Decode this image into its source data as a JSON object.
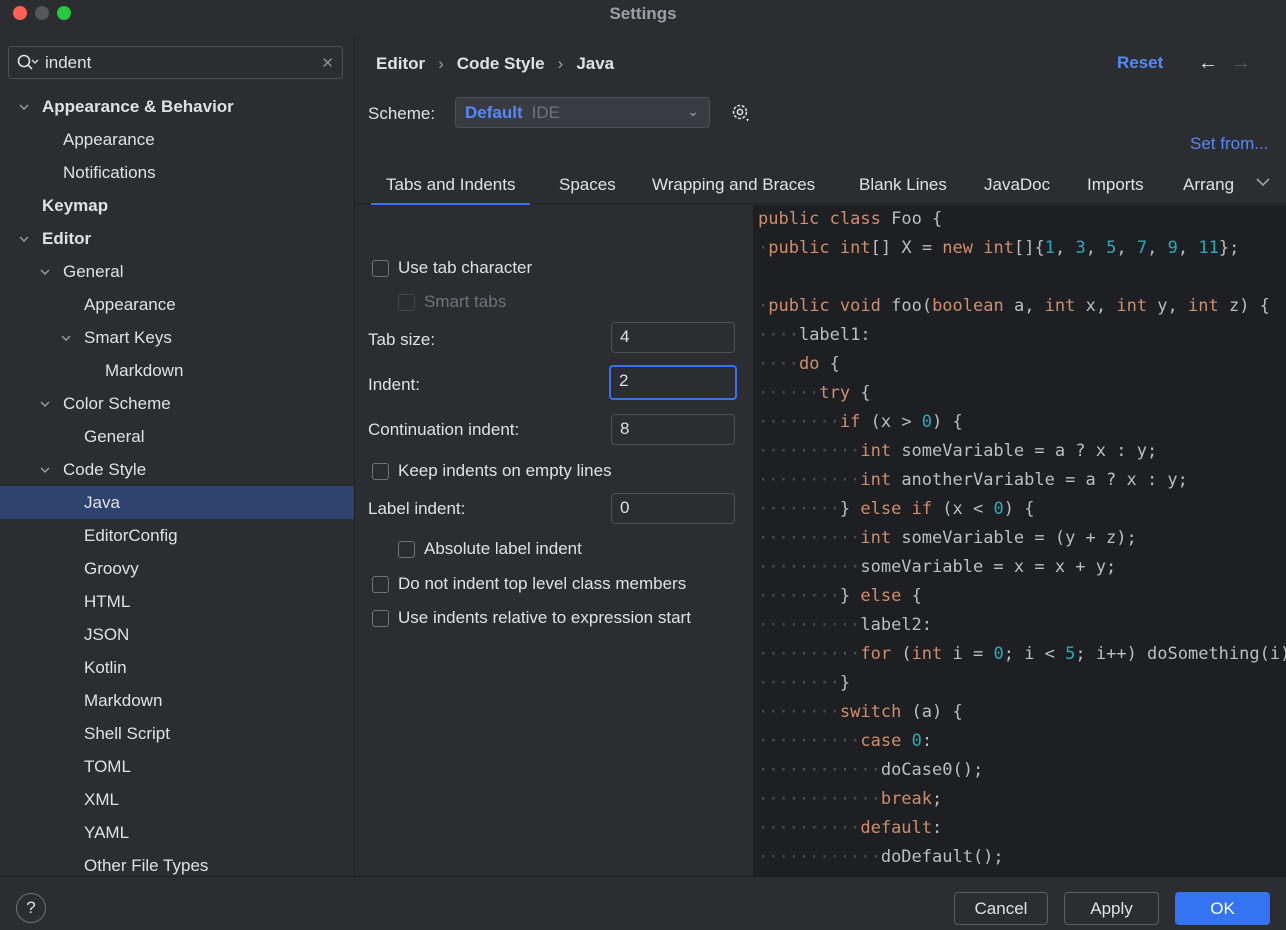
{
  "window": {
    "title": "Settings"
  },
  "search": {
    "value": "indent"
  },
  "tree": [
    {
      "label": "Appearance & Behavior",
      "bold": true,
      "chevron": "down",
      "level": 0
    },
    {
      "label": "Appearance",
      "level": 1
    },
    {
      "label": "Notifications",
      "level": 1
    },
    {
      "label": "Keymap",
      "bold": true,
      "level": 0
    },
    {
      "label": "Editor",
      "bold": true,
      "chevron": "down",
      "level": 0
    },
    {
      "label": "General",
      "chevron": "down",
      "level": 1
    },
    {
      "label": "Appearance",
      "level": 2
    },
    {
      "label": "Smart Keys",
      "chevron": "down",
      "level": 2
    },
    {
      "label": "Markdown",
      "level": 3
    },
    {
      "label": "Color Scheme",
      "chevron": "down",
      "level": 1
    },
    {
      "label": "General",
      "level": 2
    },
    {
      "label": "Code Style",
      "chevron": "down",
      "level": 1
    },
    {
      "label": "Java",
      "level": 2,
      "selected": true
    },
    {
      "label": "EditorConfig",
      "level": 2
    },
    {
      "label": "Groovy",
      "level": 2
    },
    {
      "label": "HTML",
      "level": 2
    },
    {
      "label": "JSON",
      "level": 2
    },
    {
      "label": "Kotlin",
      "level": 2
    },
    {
      "label": "Markdown",
      "level": 2
    },
    {
      "label": "Shell Script",
      "level": 2
    },
    {
      "label": "TOML",
      "level": 2
    },
    {
      "label": "XML",
      "level": 2
    },
    {
      "label": "YAML",
      "level": 2
    },
    {
      "label": "Other File Types",
      "level": 2
    }
  ],
  "breadcrumb": [
    "Editor",
    "Code Style",
    "Java"
  ],
  "header": {
    "reset": "Reset",
    "back": "←",
    "forward": "→"
  },
  "scheme": {
    "label": "Scheme:",
    "value": "Default",
    "type": "IDE"
  },
  "set_from": "Set from...",
  "tabs": [
    "Tabs and Indents",
    "Spaces",
    "Wrapping and Braces",
    "Blank Lines",
    "JavaDoc",
    "Imports",
    "Arrang"
  ],
  "options": {
    "use_tab_character": "Use tab character",
    "smart_tabs": "Smart tabs",
    "tab_size_label": "Tab size:",
    "tab_size": "4",
    "indent_label": "Indent:",
    "indent": "2",
    "continuation_label": "Continuation indent:",
    "continuation": "8",
    "keep_indents": "Keep indents on empty lines",
    "label_indent_label": "Label indent:",
    "label_indent": "0",
    "absolute_label": "Absolute label indent",
    "no_indent_top": "Do not indent top level class members",
    "relative_indents": "Use indents relative to expression start"
  },
  "code_lines": [
    [
      [
        "",
        "kw",
        "public"
      ],
      [
        " ",
        "ws",
        ""
      ],
      [
        "",
        "kw",
        "class"
      ],
      [
        " Foo {",
        "",
        ""
      ]
    ],
    [
      [
        "·",
        "ws",
        ""
      ],
      [
        "",
        "kw",
        "public"
      ],
      [
        " ",
        "",
        ""
      ],
      [
        "",
        "kw",
        "int"
      ],
      [
        "[] X = ",
        "",
        ""
      ],
      [
        "",
        "kw",
        "new"
      ],
      [
        " ",
        "",
        ""
      ],
      [
        "",
        "kw",
        "int"
      ],
      [
        "[]{",
        "",
        ""
      ],
      [
        "",
        "num",
        "1"
      ],
      [
        ", ",
        "",
        ""
      ],
      [
        "",
        "num",
        "3"
      ],
      [
        ", ",
        "",
        ""
      ],
      [
        "",
        "num",
        "5"
      ],
      [
        ", ",
        "",
        ""
      ],
      [
        "",
        "num",
        "7"
      ],
      [
        ", ",
        "",
        ""
      ],
      [
        "",
        "num",
        "9"
      ],
      [
        ", ",
        "",
        ""
      ],
      [
        "",
        "num",
        "11"
      ],
      [
        "};",
        "",
        ""
      ]
    ],
    [],
    [
      [
        "·",
        "ws",
        ""
      ],
      [
        "",
        "kw",
        "public"
      ],
      [
        " ",
        "",
        ""
      ],
      [
        "",
        "kw",
        "void"
      ],
      [
        " foo(",
        "",
        ""
      ],
      [
        "",
        "kw",
        "boolean"
      ],
      [
        " a, ",
        "",
        ""
      ],
      [
        "",
        "kw",
        "int"
      ],
      [
        " x, ",
        "",
        ""
      ],
      [
        "",
        "kw",
        "int"
      ],
      [
        " y, ",
        "",
        ""
      ],
      [
        "",
        "kw",
        "int"
      ],
      [
        " z) {",
        "",
        ""
      ]
    ],
    [
      [
        "····",
        "ws",
        ""
      ],
      [
        "label1:",
        "",
        ""
      ]
    ],
    [
      [
        "····",
        "ws",
        ""
      ],
      [
        "",
        "kw",
        "do"
      ],
      [
        " {",
        "",
        ""
      ]
    ],
    [
      [
        "······",
        "ws",
        ""
      ],
      [
        "",
        "kw",
        "try"
      ],
      [
        " {",
        "",
        ""
      ]
    ],
    [
      [
        "········",
        "ws",
        ""
      ],
      [
        "",
        "kw",
        "if"
      ],
      [
        " (x > ",
        "",
        ""
      ],
      [
        "",
        "num",
        "0"
      ],
      [
        ") {",
        "",
        ""
      ]
    ],
    [
      [
        "··········",
        "ws",
        ""
      ],
      [
        "",
        "kw",
        "int"
      ],
      [
        " someVariable = a ? x : y;",
        "",
        ""
      ]
    ],
    [
      [
        "··········",
        "ws",
        ""
      ],
      [
        "",
        "kw",
        "int"
      ],
      [
        " anotherVariable = a ? x : y;",
        "",
        ""
      ]
    ],
    [
      [
        "········",
        "ws",
        ""
      ],
      [
        "} ",
        "",
        ""
      ],
      [
        "",
        "kw",
        "else"
      ],
      [
        " ",
        "",
        ""
      ],
      [
        "",
        "kw",
        "if"
      ],
      [
        " (x < ",
        "",
        ""
      ],
      [
        "",
        "num",
        "0"
      ],
      [
        ") {",
        "",
        ""
      ]
    ],
    [
      [
        "··········",
        "ws",
        ""
      ],
      [
        "",
        "kw",
        "int"
      ],
      [
        " someVariable = (y + z);",
        "",
        ""
      ]
    ],
    [
      [
        "··········",
        "ws",
        ""
      ],
      [
        "someVariable = x = x + y;",
        "",
        ""
      ]
    ],
    [
      [
        "········",
        "ws",
        ""
      ],
      [
        "} ",
        "",
        ""
      ],
      [
        "",
        "kw",
        "else"
      ],
      [
        " {",
        "",
        ""
      ]
    ],
    [
      [
        "··········",
        "ws",
        ""
      ],
      [
        "label2:",
        "",
        ""
      ]
    ],
    [
      [
        "··········",
        "ws",
        ""
      ],
      [
        "",
        "kw",
        "for"
      ],
      [
        " (",
        "",
        ""
      ],
      [
        "",
        "kw",
        "int"
      ],
      [
        " i = ",
        "",
        ""
      ],
      [
        "",
        "num",
        "0"
      ],
      [
        "; i < ",
        "",
        ""
      ],
      [
        "",
        "num",
        "5"
      ],
      [
        "; i++) doSomething(i);",
        "",
        ""
      ]
    ],
    [
      [
        "········",
        "ws",
        ""
      ],
      [
        "}",
        "",
        ""
      ]
    ],
    [
      [
        "········",
        "ws",
        ""
      ],
      [
        "",
        "kw",
        "switch"
      ],
      [
        " (a) {",
        "",
        ""
      ]
    ],
    [
      [
        "··········",
        "ws",
        ""
      ],
      [
        "",
        "kw",
        "case"
      ],
      [
        " ",
        "",
        ""
      ],
      [
        "",
        "num",
        "0"
      ],
      [
        ":",
        "",
        ""
      ]
    ],
    [
      [
        "············",
        "ws",
        ""
      ],
      [
        "doCase0();",
        "",
        ""
      ]
    ],
    [
      [
        "············",
        "ws",
        ""
      ],
      [
        "",
        "kw",
        "break"
      ],
      [
        ";",
        "",
        ""
      ]
    ],
    [
      [
        "··········",
        "ws",
        ""
      ],
      [
        "",
        "kw",
        "default"
      ],
      [
        ":",
        "",
        ""
      ]
    ],
    [
      [
        "············",
        "ws",
        ""
      ],
      [
        "doDefault();",
        "",
        ""
      ]
    ],
    [
      [
        "········",
        "ws",
        ""
      ],
      [
        "}",
        "",
        ""
      ]
    ]
  ],
  "footer": {
    "help": "?",
    "cancel": "Cancel",
    "apply": "Apply",
    "ok": "OK"
  },
  "colors": {
    "accent": "#3574f0",
    "link": "#548af7",
    "selected_row": "#2e436e",
    "keyword": "#cf8e6d",
    "number": "#2aacb8"
  }
}
